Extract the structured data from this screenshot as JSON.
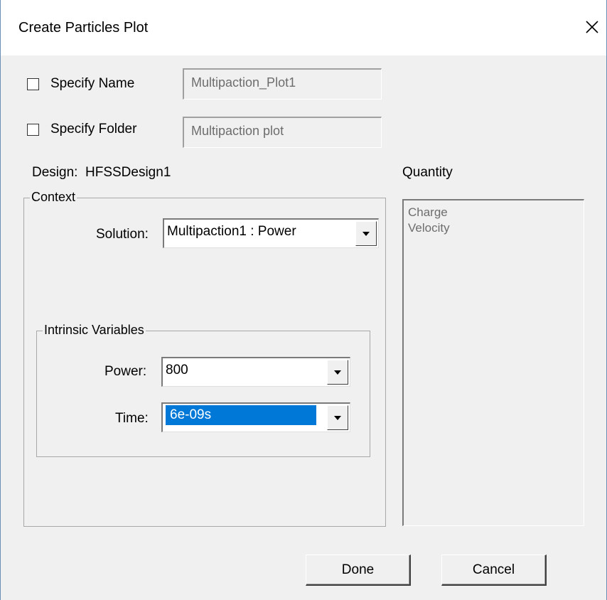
{
  "window": {
    "title": "Create Particles Plot",
    "close_icon": "close-icon"
  },
  "specify_name": {
    "label": "Specify Name",
    "checked": false,
    "value": "Multipaction_Plot1"
  },
  "specify_folder": {
    "label": "Specify Folder",
    "checked": false,
    "value": "Multipaction plot"
  },
  "design": {
    "label": "Design:",
    "value": "HFSSDesign1"
  },
  "context": {
    "title": "Context",
    "solution": {
      "label": "Solution:",
      "value": "Multipaction1 : Power"
    },
    "intrinsic": {
      "title": "Intrinsic Variables",
      "power": {
        "label": "Power:",
        "value": "800"
      },
      "time": {
        "label": "Time:",
        "value": "6e-09s"
      }
    }
  },
  "quantity": {
    "label": "Quantity",
    "items": [
      "Charge",
      "Velocity"
    ]
  },
  "buttons": {
    "done": "Done",
    "cancel": "Cancel"
  },
  "colors": {
    "selection": "#0078d7",
    "background": "#f0f0f0",
    "frame": "#6b8fb5"
  }
}
